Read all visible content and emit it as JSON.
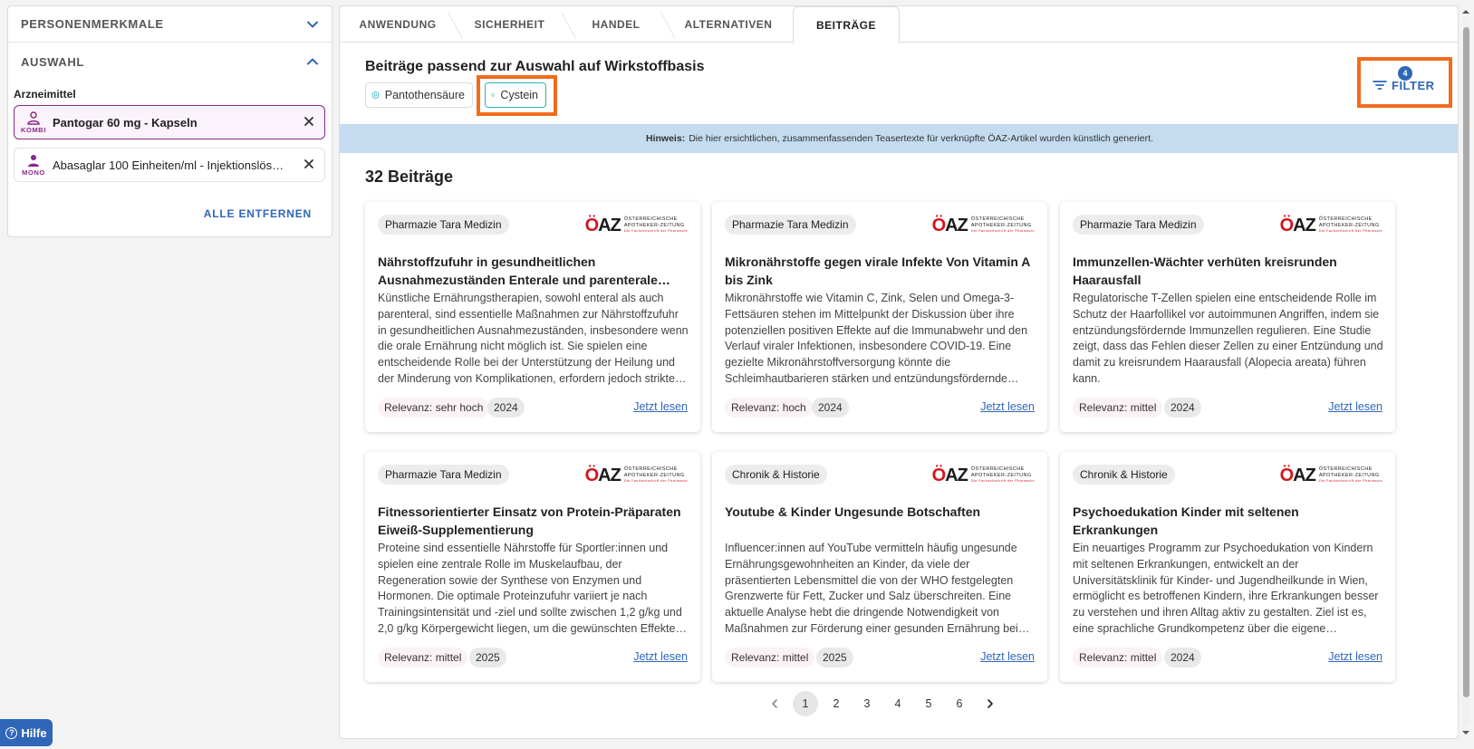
{
  "sidebar": {
    "personal_section": "PERSONENMERKMALE",
    "selection_section": "AUSWAHL",
    "drugs_label": "Arzneimittel",
    "drugs": [
      {
        "tag": "KOMBI",
        "name": "Pantogar 60 mg - Kapseln"
      },
      {
        "tag": "MONO",
        "name": "Abasaglar 100 Einheiten/ml - Injektionslösung in einer Patrone"
      }
    ],
    "remove_all": "ALLE ENTFERNEN"
  },
  "tabs": [
    "ANWENDUNG",
    "SICHERHEIT",
    "HANDEL",
    "ALTERNATIVEN",
    "BEITRÄGE"
  ],
  "active_tab": "BEITRÄGE",
  "main": {
    "heading": "Beiträge passend zur Auswahl auf Wirkstoffbasis",
    "chips": [
      "Pantothensäure",
      "Cystein"
    ],
    "filter_label": "FILTER",
    "filter_count": "4",
    "notice_bold": "Hinweis:",
    "notice_text": "Die hier ersichtlichen, zusammenfassenden Teasertexte für verknüpfte ÖAZ-Artikel wurden künstlich generiert.",
    "count_label": "32 Beiträge"
  },
  "logo": {
    "o": "Ö",
    "az": "AZ",
    "line1": "ÖSTERREICHISCHE",
    "line2": "APOTHEKER-ZEITUNG",
    "line3": "Die Fachzeitschrift der Pharmazie"
  },
  "read_label": "Jetzt lesen",
  "cards": [
    {
      "category": "Pharmazie Tara Medizin",
      "title": "Nährstoffzufuhr in gesundheitlichen Ausnahmezuständen Enterale und parenterale Ernährung",
      "text": "Künstliche Ernährungstherapien, sowohl enteral als auch parenteral, sind essentielle Maßnahmen zur Nährstoffzufuhr in gesundheitlichen Ausnahmezuständen, insbesondere wenn die orale Ernährung nicht möglich ist. Sie spielen eine entscheidende Rolle bei der Unterstützung der Heilung und der Minderung von Komplikationen, erfordern jedoch strikte Überwachung.",
      "relevance": "Relevanz: sehr hoch",
      "year": "2024"
    },
    {
      "category": "Pharmazie Tara Medizin",
      "title": "Mikronährstoffe gegen virale Infekte Von Vitamin A bis Zink",
      "text": "Mikronährstoffe wie Vitamin C, Zink, Selen und Omega-3-Fettsäuren stehen im Mittelpunkt der Diskussion über ihre potenziellen positiven Effekte auf die Immunabwehr und den Verlauf viraler Infektionen, insbesondere COVID-19. Eine gezielte Mikronährstoffversorgung könnte die Schleimhautbarieren stärken und entzündungsfördernde Prozesse mindern.",
      "relevance": "Relevanz: hoch",
      "year": "2024"
    },
    {
      "category": "Pharmazie Tara Medizin",
      "title": "Immunzellen-Wächter verhüten kreisrunden Haarausfall",
      "text": "Regulatorische T-Zellen spielen eine entscheidende Rolle im Schutz der Haarfollikel vor autoimmunen Angriffen, indem sie entzündungsfördernde Immunzellen regulieren. Eine Studie zeigt, dass das Fehlen dieser Zellen zu einer Entzündung und damit zu kreisrundem Haarausfall (Alopecia areata) führen kann.",
      "relevance": "Relevanz: mittel",
      "year": "2024"
    },
    {
      "category": "Pharmazie Tara Medizin",
      "title": "Fitnessorientierter Einsatz von Protein-Präparaten Eiweiß-Supplementierung",
      "text": "Proteine sind essentielle Nährstoffe für Sportler:innen und spielen eine zentrale Rolle im Muskelaufbau, der Regeneration sowie der Synthese von Enzymen und Hormonen. Die optimale Proteinzufuhr variiert je nach Trainingsintensität und -ziel und sollte zwischen 1,2 g/kg und 2,0 g/kg Körpergewicht liegen, um die gewünschten Effekte zu erzielen.",
      "relevance": "Relevanz: mittel",
      "year": "2025"
    },
    {
      "category": "Chronik & Historie",
      "title": "Youtube & Kinder Ungesunde Botschaften",
      "text": "Influencer:innen auf YouTube vermitteln häufig ungesunde Ernährungsgewohnheiten an Kinder, da viele der präsentierten Lebensmittel die von der WHO festgelegten Grenzwerte für Fett, Zucker und Salz überschreiten. Eine aktuelle Analyse hebt die dringende Notwendigkeit von Maßnahmen zur Förderung einer gesunden Ernährung bei Kindern hervor.",
      "relevance": "Relevanz: mittel",
      "year": "2025"
    },
    {
      "category": "Chronik & Historie",
      "title": "Psychoedukation Kinder mit seltenen Erkrankungen",
      "text": "Ein neuartiges Programm zur Psychoedukation von Kindern mit seltenen Erkrankungen, entwickelt an der Universitätsklinik für Kinder- und Jugendheilkunde in Wien, ermöglicht es betroffenen Kindern, ihre Erkrankungen besser zu verstehen und ihren Alltag aktiv zu gestalten. Ziel ist es, eine sprachliche Grundkompetenz über die eigene Erkrankung aufzubauen.",
      "relevance": "Relevanz: mittel",
      "year": "2024"
    }
  ],
  "pagination": {
    "pages": [
      "1",
      "2",
      "3",
      "4",
      "5",
      "6"
    ],
    "current": "1"
  },
  "help_label": "Hilfe",
  "help_icon": "?",
  "colors": {
    "accent": "#2f66b8",
    "brand_purple": "#8b2a87",
    "highlight": "#f26b1d",
    "notice_bg": "#c4dbf0",
    "chip_teal": "#2ab4b4"
  }
}
